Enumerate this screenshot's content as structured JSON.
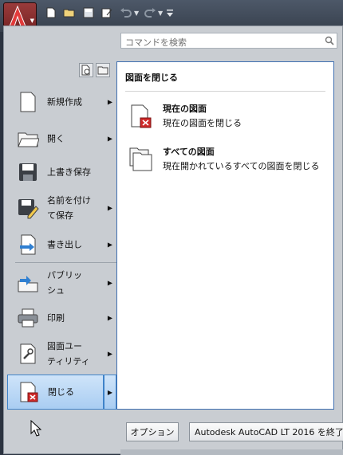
{
  "app": {
    "logo_text": "LT",
    "accent": "#a11d1d"
  },
  "quick_access": [
    "new-icon",
    "open-icon",
    "save-icon",
    "plot-icon",
    "undo-icon",
    "redo-icon",
    "customize-icon"
  ],
  "search": {
    "placeholder": "コマンドを検索"
  },
  "menu": {
    "items": [
      {
        "label": "新規作成",
        "icon": "new-doc-icon",
        "submenu": true
      },
      {
        "label": "開く",
        "icon": "folder-icon",
        "submenu": true
      },
      {
        "label": "上書き保存",
        "icon": "save-icon",
        "submenu": false
      },
      {
        "label": "名前を付け\nて保存",
        "icon": "save-as-icon",
        "submenu": true
      },
      {
        "label": "書き出し",
        "icon": "export-icon",
        "submenu": true
      },
      {
        "label": "パブリッ\nシュ",
        "icon": "publish-icon",
        "submenu": true
      },
      {
        "label": "印刷",
        "icon": "print-icon",
        "submenu": true
      },
      {
        "label": "図面ユー\nティリティ",
        "icon": "drawing-utilities-icon",
        "submenu": true
      },
      {
        "label": "閉じる",
        "icon": "close-doc-icon",
        "submenu": true,
        "selected": true
      }
    ]
  },
  "panel": {
    "title": "図面を閉じる",
    "items": [
      {
        "title": "現在の図面",
        "desc": "現在の図面を閉じる",
        "icon": "close-current-drawing-icon"
      },
      {
        "title": "すべての図面",
        "desc": "現在開かれているすべての図面を閉じる",
        "icon": "close-all-drawings-icon"
      }
    ]
  },
  "footer": {
    "options_label": "オプション",
    "exit_label": "Autodesk AutoCAD LT 2016 を終了"
  }
}
